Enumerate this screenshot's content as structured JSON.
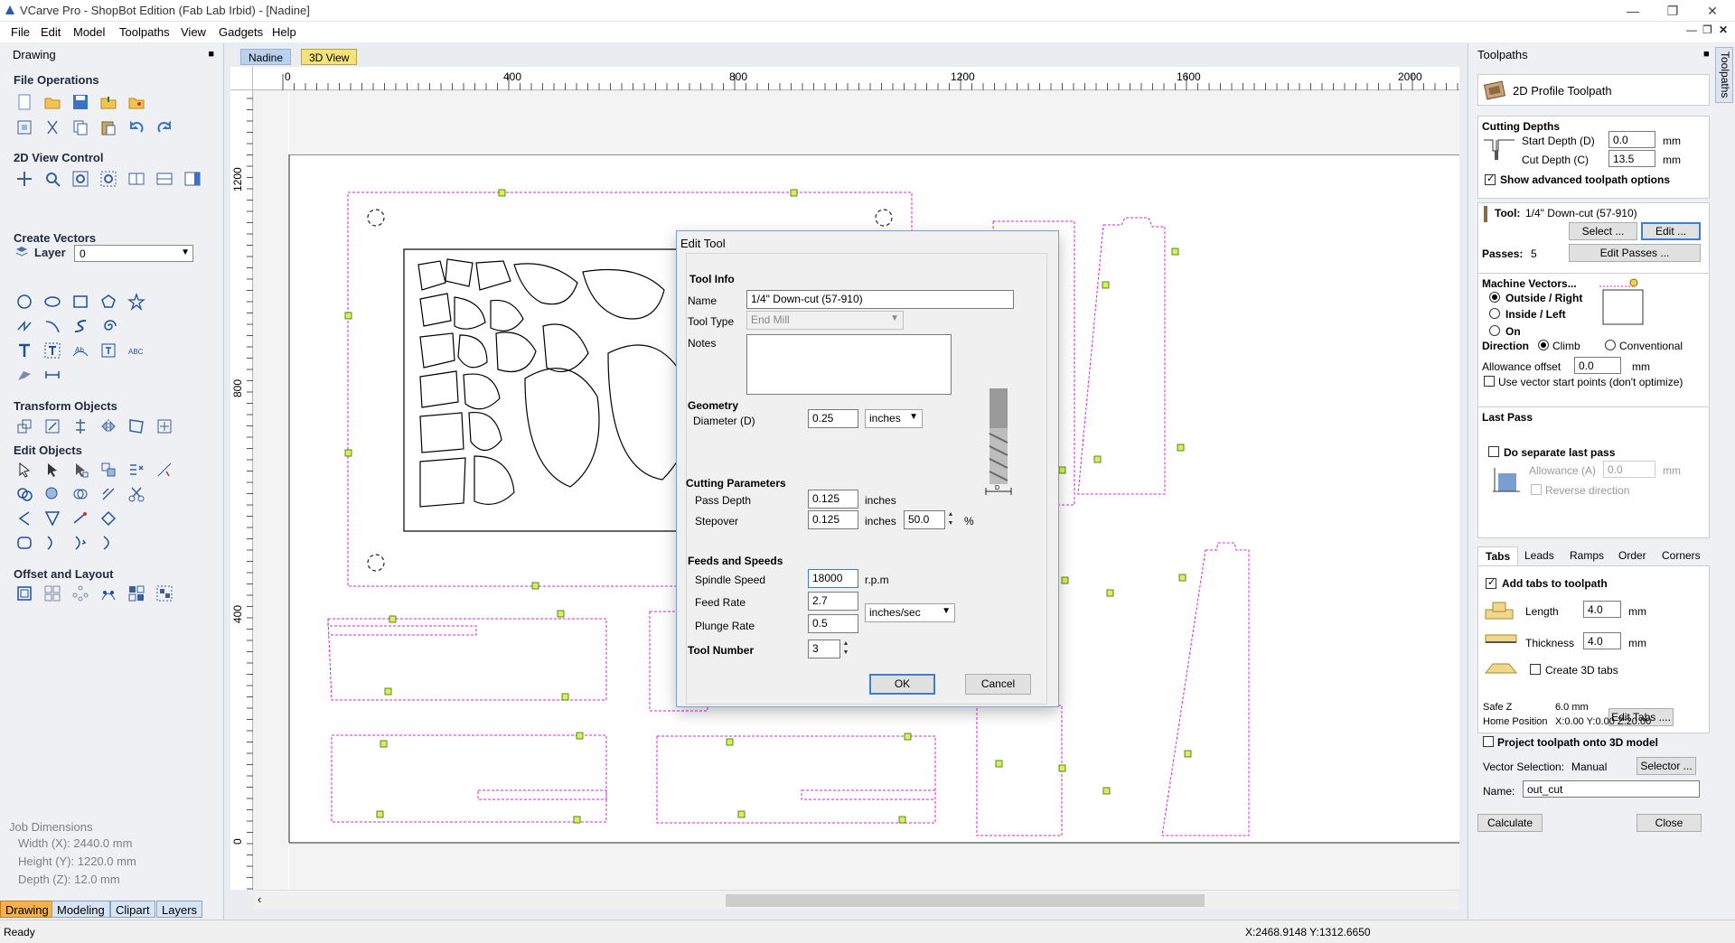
{
  "app": {
    "title": "VCarve Pro - ShopBot Edition (Fab Lab Irbid) - [Nadine]",
    "menu": [
      "File",
      "Edit",
      "Model",
      "Toolpaths",
      "View",
      "Gadgets",
      "Help"
    ]
  },
  "left_panel": {
    "title": "Drawing",
    "sections": {
      "file_ops": "File Operations",
      "view2d": "2D View Control",
      "create_vectors": "Create Vectors",
      "transform": "Transform Objects",
      "edit_objects": "Edit Objects",
      "offset_layout": "Offset and Layout"
    },
    "layer_label": "Layer",
    "layer_value": "0",
    "job_dimensions": {
      "title": "Job Dimensions",
      "width": "Width  (X): 2440.0 mm",
      "height": "Height (Y): 1220.0 mm",
      "depth": "Depth  (Z): 12.0 mm"
    },
    "tabs": [
      "Drawing",
      "Modeling",
      "Clipart",
      "Layers"
    ]
  },
  "document_tabs": [
    "Nadine",
    "3D View"
  ],
  "ruler": {
    "top": [
      "0",
      "400",
      "800",
      "1200",
      "1600",
      "2000"
    ],
    "left": [
      "1200",
      "800",
      "400",
      "0"
    ]
  },
  "dialog": {
    "title": "Edit Tool",
    "tool_info": "Tool Info",
    "name_label": "Name",
    "name_value": "1/4\" Down-cut (57-910)",
    "tool_type_label": "Tool Type",
    "tool_type_value": "End Mill",
    "notes_label": "Notes",
    "geometry": "Geometry",
    "diameter_label": "Diameter (D)",
    "diameter_value": "0.25",
    "diameter_units": "inches",
    "cutting_params": "Cutting Parameters",
    "pass_depth_label": "Pass Depth",
    "pass_depth_value": "0.125",
    "pass_depth_units": "inches",
    "stepover_label": "Stepover",
    "stepover_value": "0.125",
    "stepover_units": "inches",
    "stepover_percent": "50.0",
    "percent_sign": "%",
    "feeds_speeds": "Feeds and Speeds",
    "spindle_label": "Spindle Speed",
    "spindle_value": "18000",
    "spindle_units": "r.p.m",
    "feed_label": "Feed Rate",
    "feed_value": "2.7",
    "rate_units": "inches/sec",
    "plunge_label": "Plunge Rate",
    "plunge_value": "0.5",
    "tool_number_label": "Tool Number",
    "tool_number_value": "3",
    "ok": "OK",
    "cancel": "Cancel"
  },
  "right_panel": {
    "title": "Toolpaths",
    "vtab": "Toolpaths",
    "toolpath_type": "2D Profile Toolpath",
    "cutting_depths": "Cutting Depths",
    "start_depth_label": "Start Depth (D)",
    "start_depth_value": "0.0",
    "cut_depth_label": "Cut Depth (C)",
    "cut_depth_value": "13.5",
    "mm": "mm",
    "show_advanced": "Show advanced toolpath options",
    "tool_label": "Tool:",
    "tool_value": "1/4\" Down-cut (57-910)",
    "select_btn": "Select ...",
    "edit_btn": "Edit ...",
    "passes_label": "Passes:",
    "passes_value": "5",
    "edit_passes_btn": "Edit Passes ...",
    "machine_vectors": "Machine Vectors...",
    "outside_right": "Outside / Right",
    "inside_left": "Inside / Left",
    "on": "On",
    "direction": "Direction",
    "climb": "Climb",
    "conventional": "Conventional",
    "allowance_label": "Allowance offset",
    "allowance_value": "0.0",
    "use_vector_start": "Use vector start points (don't optimize)",
    "last_pass": "Last Pass",
    "separate_last_pass": "Do separate last pass",
    "allowance_a_label": "Allowance (A)",
    "allowance_a_value": "0.0",
    "reverse_direction": "Reverse direction",
    "tabs": [
      "Tabs",
      "Leads",
      "Ramps",
      "Order",
      "Corners"
    ],
    "add_tabs": "Add tabs to toolpath",
    "length_label": "Length",
    "length_value": "4.0",
    "thickness_label": "Thickness",
    "thickness_value": "4.0",
    "create_3d_tabs": "Create 3D tabs",
    "edit_tabs_btn": "Edit Tabs ....",
    "safe_z_label": "Safe Z",
    "safe_z_value": "6.0 mm",
    "home_label": "Home Position",
    "home_value": "X:0.00 Y:0.00 Z:20.00",
    "project_toolpath": "Project toolpath onto 3D model",
    "vector_selection_label": "Vector Selection:",
    "vector_selection_value": "Manual",
    "selector_btn": "Selector ...",
    "name_label": "Name:",
    "name_value": "out_cut",
    "calculate_btn": "Calculate",
    "close_btn": "Close"
  },
  "status": {
    "text": "Ready",
    "coords": "X:2468.9148 Y:1312.6650"
  },
  "colors": {
    "toolpath_outline": "#e020e0",
    "tab_marker": "#d4f25a",
    "active_tab": "#f5b14b",
    "doc_tab_active": "#f4e27a"
  }
}
